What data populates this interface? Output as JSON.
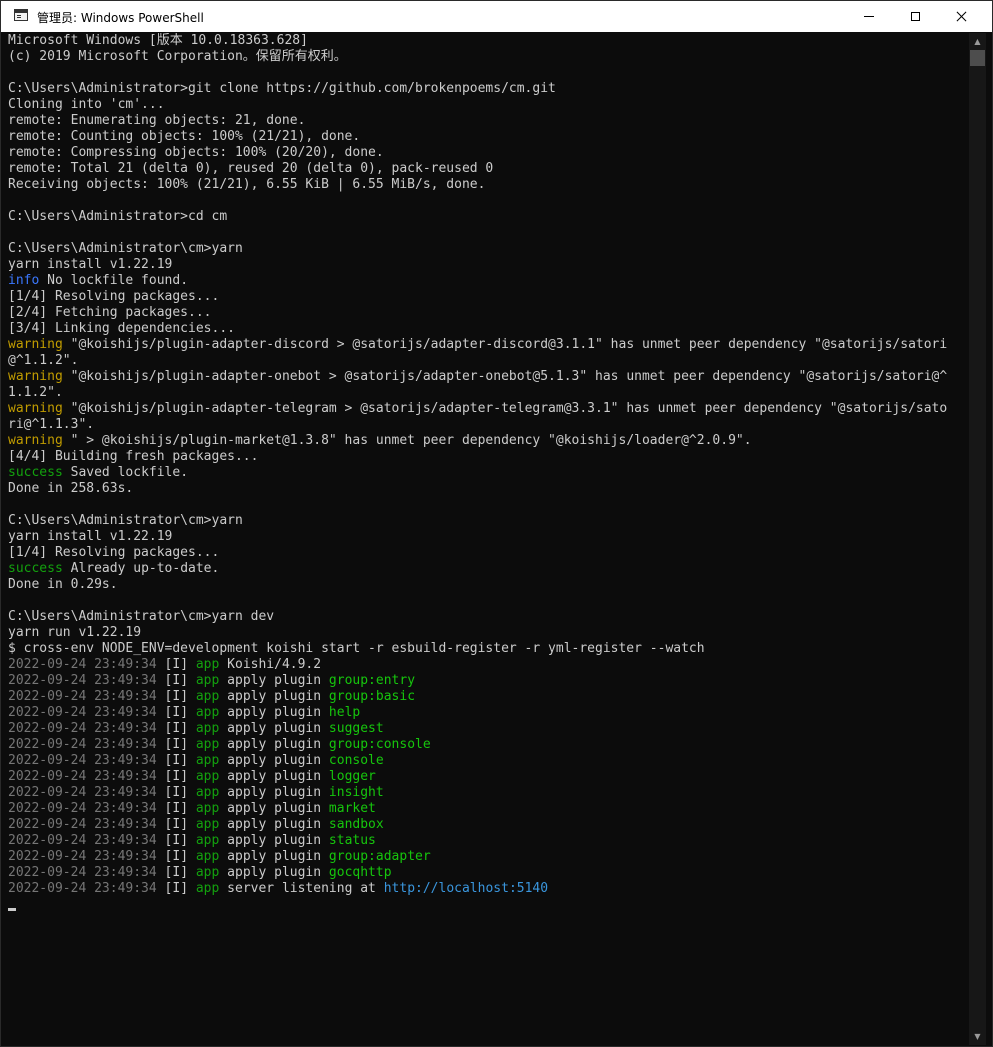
{
  "window": {
    "title": "管理员: Windows PowerShell"
  },
  "colors": {
    "background": "#0c0c0c",
    "text": "#cccccc",
    "info": "#3b78ff",
    "warning": "#c19c00",
    "success": "#13a10e",
    "timestamp": "#767676",
    "app": "#13a10e",
    "highlight": "#16c60c",
    "link": "#3a96dd"
  },
  "icons": {
    "window_icon": "powershell-window-icon",
    "minimize": "minimize-icon",
    "maximize": "maximize-icon",
    "close": "close-icon",
    "scroll_up": "scroll-up-arrow-icon",
    "scroll_down": "scroll-down-arrow-icon"
  },
  "console": {
    "lines": [
      [
        {
          "t": "Microsoft Windows [版本 10.0.18363.628]"
        }
      ],
      [
        {
          "t": "(c) 2019 Microsoft Corporation。保留所有权利。"
        }
      ],
      [
        {
          "t": ""
        }
      ],
      [
        {
          "t": "C:\\Users\\Administrator>git clone https://github.com/brokenpoems/cm.git"
        }
      ],
      [
        {
          "t": "Cloning into 'cm'..."
        }
      ],
      [
        {
          "t": "remote: Enumerating objects: 21, done."
        }
      ],
      [
        {
          "t": "remote: Counting objects: 100% (21/21), done."
        }
      ],
      [
        {
          "t": "remote: Compressing objects: 100% (20/20), done."
        }
      ],
      [
        {
          "t": "remote: Total 21 (delta 0), reused 20 (delta 0), pack-reused 0"
        }
      ],
      [
        {
          "t": "Receiving objects: 100% (21/21), 6.55 KiB | 6.55 MiB/s, done."
        }
      ],
      [
        {
          "t": ""
        }
      ],
      [
        {
          "t": "C:\\Users\\Administrator>cd cm"
        }
      ],
      [
        {
          "t": ""
        }
      ],
      [
        {
          "t": "C:\\Users\\Administrator\\cm>yarn"
        }
      ],
      [
        {
          "t": "yarn install v1.22.19"
        }
      ],
      [
        {
          "t": "info",
          "c": "c-blue"
        },
        {
          "t": " No lockfile found."
        }
      ],
      [
        {
          "t": "[1/4] Resolving packages..."
        }
      ],
      [
        {
          "t": "[2/4] Fetching packages..."
        }
      ],
      [
        {
          "t": "[3/4] Linking dependencies..."
        }
      ],
      [
        {
          "t": "warning",
          "c": "c-yellow"
        },
        {
          "t": " \"@koishijs/plugin-adapter-discord > @satorijs/adapter-discord@3.1.1\" has unmet peer dependency \"@satorijs/satori"
        }
      ],
      [
        {
          "t": "@^1.1.2\"."
        }
      ],
      [
        {
          "t": "warning",
          "c": "c-yellow"
        },
        {
          "t": " \"@koishijs/plugin-adapter-onebot > @satorijs/adapter-onebot@5.1.3\" has unmet peer dependency \"@satorijs/satori@^"
        }
      ],
      [
        {
          "t": "1.1.2\"."
        }
      ],
      [
        {
          "t": "warning",
          "c": "c-yellow"
        },
        {
          "t": " \"@koishijs/plugin-adapter-telegram > @satorijs/adapter-telegram@3.3.1\" has unmet peer dependency \"@satorijs/sato"
        }
      ],
      [
        {
          "t": "ri@^1.1.3\"."
        }
      ],
      [
        {
          "t": "warning",
          "c": "c-yellow"
        },
        {
          "t": " \" > @koishijs/plugin-market@1.3.8\" has unmet peer dependency \"@koishijs/loader@^2.0.9\"."
        }
      ],
      [
        {
          "t": "[4/4] Building fresh packages..."
        }
      ],
      [
        {
          "t": "success",
          "c": "c-green"
        },
        {
          "t": " Saved lockfile."
        }
      ],
      [
        {
          "t": "Done in 258.63s."
        }
      ],
      [
        {
          "t": ""
        }
      ],
      [
        {
          "t": "C:\\Users\\Administrator\\cm>yarn"
        }
      ],
      [
        {
          "t": "yarn install v1.22.19"
        }
      ],
      [
        {
          "t": "[1/4] Resolving packages..."
        }
      ],
      [
        {
          "t": "success",
          "c": "c-green"
        },
        {
          "t": " Already up-to-date."
        }
      ],
      [
        {
          "t": "Done in 0.29s."
        }
      ],
      [
        {
          "t": ""
        }
      ],
      [
        {
          "t": "C:\\Users\\Administrator\\cm>yarn dev"
        }
      ],
      [
        {
          "t": "yarn run v1.22.19"
        }
      ],
      [
        {
          "t": "$ cross-env NODE_ENV=development koishi start -r esbuild-register -r yml-register --watch"
        }
      ],
      [
        {
          "t": "2022-09-24 23:49:34",
          "c": "c-gray"
        },
        {
          "t": " [I] "
        },
        {
          "t": "app",
          "c": "c-green"
        },
        {
          "t": " Koishi/4.9.2"
        }
      ],
      [
        {
          "t": "2022-09-24 23:49:34",
          "c": "c-gray"
        },
        {
          "t": " [I] "
        },
        {
          "t": "app",
          "c": "c-green"
        },
        {
          "t": " apply plugin "
        },
        {
          "t": "group:entry",
          "c": "c-lgreen"
        }
      ],
      [
        {
          "t": "2022-09-24 23:49:34",
          "c": "c-gray"
        },
        {
          "t": " [I] "
        },
        {
          "t": "app",
          "c": "c-green"
        },
        {
          "t": " apply plugin "
        },
        {
          "t": "group:basic",
          "c": "c-lgreen"
        }
      ],
      [
        {
          "t": "2022-09-24 23:49:34",
          "c": "c-gray"
        },
        {
          "t": " [I] "
        },
        {
          "t": "app",
          "c": "c-green"
        },
        {
          "t": " apply plugin "
        },
        {
          "t": "help",
          "c": "c-lgreen"
        }
      ],
      [
        {
          "t": "2022-09-24 23:49:34",
          "c": "c-gray"
        },
        {
          "t": " [I] "
        },
        {
          "t": "app",
          "c": "c-green"
        },
        {
          "t": " apply plugin "
        },
        {
          "t": "suggest",
          "c": "c-lgreen"
        }
      ],
      [
        {
          "t": "2022-09-24 23:49:34",
          "c": "c-gray"
        },
        {
          "t": " [I] "
        },
        {
          "t": "app",
          "c": "c-green"
        },
        {
          "t": " apply plugin "
        },
        {
          "t": "group:console",
          "c": "c-lgreen"
        }
      ],
      [
        {
          "t": "2022-09-24 23:49:34",
          "c": "c-gray"
        },
        {
          "t": " [I] "
        },
        {
          "t": "app",
          "c": "c-green"
        },
        {
          "t": " apply plugin "
        },
        {
          "t": "console",
          "c": "c-lgreen"
        }
      ],
      [
        {
          "t": "2022-09-24 23:49:34",
          "c": "c-gray"
        },
        {
          "t": " [I] "
        },
        {
          "t": "app",
          "c": "c-green"
        },
        {
          "t": " apply plugin "
        },
        {
          "t": "logger",
          "c": "c-lgreen"
        }
      ],
      [
        {
          "t": "2022-09-24 23:49:34",
          "c": "c-gray"
        },
        {
          "t": " [I] "
        },
        {
          "t": "app",
          "c": "c-green"
        },
        {
          "t": " apply plugin "
        },
        {
          "t": "insight",
          "c": "c-lgreen"
        }
      ],
      [
        {
          "t": "2022-09-24 23:49:34",
          "c": "c-gray"
        },
        {
          "t": " [I] "
        },
        {
          "t": "app",
          "c": "c-green"
        },
        {
          "t": " apply plugin "
        },
        {
          "t": "market",
          "c": "c-lgreen"
        }
      ],
      [
        {
          "t": "2022-09-24 23:49:34",
          "c": "c-gray"
        },
        {
          "t": " [I] "
        },
        {
          "t": "app",
          "c": "c-green"
        },
        {
          "t": " apply plugin "
        },
        {
          "t": "sandbox",
          "c": "c-lgreen"
        }
      ],
      [
        {
          "t": "2022-09-24 23:49:34",
          "c": "c-gray"
        },
        {
          "t": " [I] "
        },
        {
          "t": "app",
          "c": "c-green"
        },
        {
          "t": " apply plugin "
        },
        {
          "t": "status",
          "c": "c-lgreen"
        }
      ],
      [
        {
          "t": "2022-09-24 23:49:34",
          "c": "c-gray"
        },
        {
          "t": " [I] "
        },
        {
          "t": "app",
          "c": "c-green"
        },
        {
          "t": " apply plugin "
        },
        {
          "t": "group:adapter",
          "c": "c-lgreen"
        }
      ],
      [
        {
          "t": "2022-09-24 23:49:34",
          "c": "c-gray"
        },
        {
          "t": " [I] "
        },
        {
          "t": "app",
          "c": "c-green"
        },
        {
          "t": " apply plugin "
        },
        {
          "t": "gocqhttp",
          "c": "c-lgreen"
        }
      ],
      [
        {
          "t": "2022-09-24 23:49:34",
          "c": "c-gray"
        },
        {
          "t": " [I] "
        },
        {
          "t": "app",
          "c": "c-green"
        },
        {
          "t": " server listening at "
        },
        {
          "t": "http://localhost:5140",
          "c": "c-cyan"
        }
      ],
      [
        {
          "t": ""
        }
      ]
    ]
  }
}
